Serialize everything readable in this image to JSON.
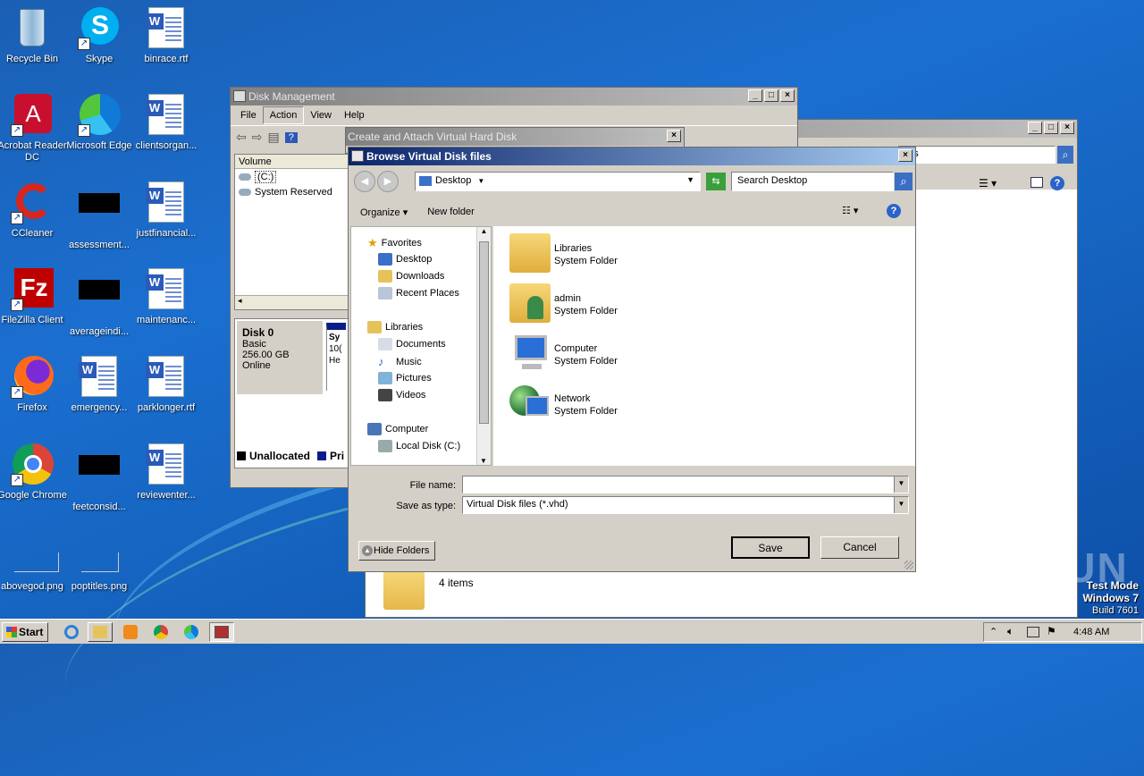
{
  "desktop": {
    "icons": [
      {
        "label": "Recycle Bin",
        "icon": "recycle-bin-icon"
      },
      {
        "label": "Skype",
        "icon": "skype-icon"
      },
      {
        "label": "binrace.rtf",
        "icon": "word-doc-icon"
      },
      {
        "label": "Acrobat Reader DC",
        "icon": "acrobat-icon"
      },
      {
        "label": "Microsoft Edge",
        "icon": "edge-icon"
      },
      {
        "label": "clientsorgan...",
        "icon": "word-doc-icon"
      },
      {
        "label": "CCleaner",
        "icon": "ccleaner-icon"
      },
      {
        "label": "assessment...",
        "icon": "black-file-icon"
      },
      {
        "label": "justfinancial...",
        "icon": "word-doc-icon"
      },
      {
        "label": "FileZilla Client",
        "icon": "filezilla-icon"
      },
      {
        "label": "averageindi...",
        "icon": "black-file-icon"
      },
      {
        "label": "maintenanc...",
        "icon": "word-doc-icon"
      },
      {
        "label": "Firefox",
        "icon": "firefox-icon"
      },
      {
        "label": "emergency...",
        "icon": "word-doc-icon"
      },
      {
        "label": "parklonger.rtf",
        "icon": "word-doc-icon"
      },
      {
        "label": "Google Chrome",
        "icon": "chrome-icon"
      },
      {
        "label": "feetconsid...",
        "icon": "black-file-icon"
      },
      {
        "label": "reviewenter...",
        "icon": "word-doc-icon"
      },
      {
        "label": "abovegod.png",
        "icon": "png-icon"
      },
      {
        "label": "poptitles.png",
        "icon": "png-icon"
      }
    ]
  },
  "disk_mgmt": {
    "title": "Disk Management",
    "menu": [
      "File",
      "Action",
      "View",
      "Help"
    ],
    "column_volume": "Volume",
    "volumes": [
      "(C:)",
      "System Reserved"
    ],
    "disk_name": "Disk 0",
    "disk_type": "Basic",
    "disk_size": "256.00 GB",
    "disk_status": "Online",
    "partition_label": "Sy",
    "partition_l2": "10(",
    "partition_l3": "He",
    "legend_unallocated": "Unallocated",
    "legend_primary": "Pri"
  },
  "create_vhd": {
    "title": "Create and Attach Virtual Hard Disk"
  },
  "bg_explorer": {
    "search_partial": "ries",
    "items_count": "4 items"
  },
  "browse": {
    "title": "Browse Virtual Disk files",
    "location": "Desktop",
    "search_placeholder": "Search Desktop",
    "organize": "Organize",
    "new_folder": "New folder",
    "nav": {
      "favorites": "Favorites",
      "desktop": "Desktop",
      "downloads": "Downloads",
      "recent": "Recent Places",
      "libraries": "Libraries",
      "documents": "Documents",
      "music": "Music",
      "pictures": "Pictures",
      "videos": "Videos",
      "computer": "Computer",
      "local_disk": "Local Disk (C:)"
    },
    "items": [
      {
        "name": "Libraries",
        "type": "System Folder"
      },
      {
        "name": "admin",
        "type": "System Folder"
      },
      {
        "name": "Computer",
        "type": "System Folder"
      },
      {
        "name": "Network",
        "type": "System Folder"
      }
    ],
    "file_name_label": "File name:",
    "file_name_value": "",
    "save_type_label": "Save as type:",
    "save_type_value": "Virtual Disk files (*.vhd)",
    "hide_folders": "Hide Folders",
    "save": "Save",
    "cancel": "Cancel"
  },
  "taskbar": {
    "start": "Start",
    "time": "4:48 AM"
  },
  "watermark": {
    "line1": "Test Mode",
    "line2": "Windows 7",
    "line3": "Build 7601",
    "brand": "ANY RUN"
  }
}
